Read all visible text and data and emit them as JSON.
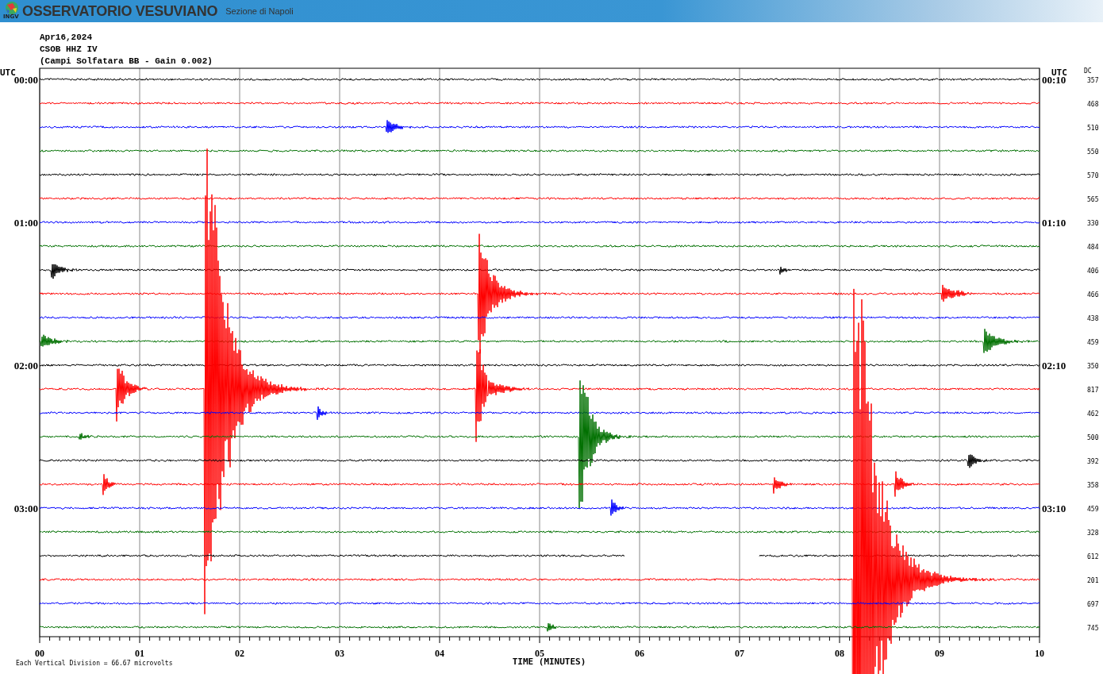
{
  "header": {
    "logo_text": "INGV",
    "title": "OSSERVATORIO VESUVIANO",
    "subtitle": "Sezione di Napoli"
  },
  "info": [
    "Apr16,2024",
    "CSOB HHZ IV",
    "(Campi Solfatara BB - Gain 0.002)"
  ],
  "plot": {
    "left_heading": "UTC",
    "right_heading": "UTC",
    "dc_heading": "DC",
    "traces": [
      {
        "color": "#000000",
        "dc": "357",
        "left_time": "00:00",
        "right_time": "00:10"
      },
      {
        "color": "#ff0000",
        "dc": "468"
      },
      {
        "color": "#0000ff",
        "dc": "510"
      },
      {
        "color": "#007000",
        "dc": "550"
      },
      {
        "color": "#000000",
        "dc": "570"
      },
      {
        "color": "#ff0000",
        "dc": "565"
      },
      {
        "color": "#0000ff",
        "dc": "330",
        "left_time": "01:00",
        "right_time": "01:10"
      },
      {
        "color": "#007000",
        "dc": "484"
      },
      {
        "color": "#000000",
        "dc": "406"
      },
      {
        "color": "#ff0000",
        "dc": "466"
      },
      {
        "color": "#0000ff",
        "dc": "438"
      },
      {
        "color": "#007000",
        "dc": "459"
      },
      {
        "color": "#000000",
        "dc": "350",
        "left_time": "02:00",
        "right_time": "02:10"
      },
      {
        "color": "#ff0000",
        "dc": "817"
      },
      {
        "color": "#0000ff",
        "dc": "462"
      },
      {
        "color": "#007000",
        "dc": "500"
      },
      {
        "color": "#000000",
        "dc": "392"
      },
      {
        "color": "#ff0000",
        "dc": "358"
      },
      {
        "color": "#0000ff",
        "dc": "459",
        "left_time": "03:00",
        "right_time": "03:10"
      },
      {
        "color": "#007000",
        "dc": "328"
      },
      {
        "color": "#000000",
        "dc": "612"
      },
      {
        "color": "#ff0000",
        "dc": "201"
      },
      {
        "color": "#0000ff",
        "dc": "697"
      },
      {
        "color": "#007000",
        "dc": "745"
      }
    ],
    "x_ticks": [
      "00",
      "01",
      "02",
      "03",
      "04",
      "05",
      "06",
      "07",
      "08",
      "09",
      "10"
    ],
    "x_axis_label": "TIME (MINUTES)",
    "footnote": "Each Vertical Division =   66.67 microvolts"
  }
}
